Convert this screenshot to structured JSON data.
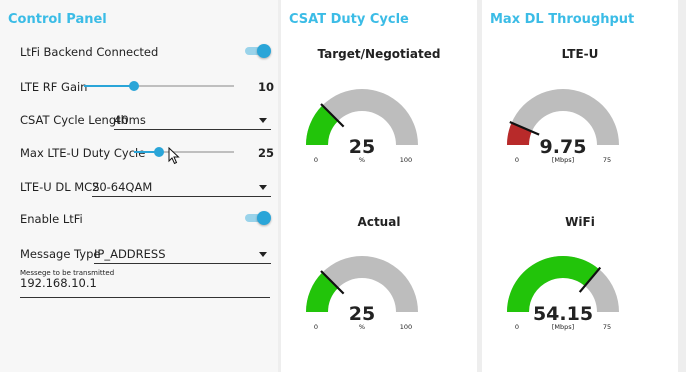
{
  "control_panel": {
    "title": "Control Panel",
    "backend_connected": {
      "label": "LtFi Backend Connected",
      "on": true
    },
    "lte_rf_gain": {
      "label": "LTE RF Gain",
      "value": "10",
      "fraction": 0.33
    },
    "csat_cycle_length": {
      "label": "CSAT Cycle Length",
      "value": "40ms"
    },
    "max_duty_cycle": {
      "label": "Max LTE-U Duty Cycle",
      "value": "25",
      "fraction": 0.25
    },
    "dl_mcs": {
      "label": "LTE-U DL MCS",
      "value": "20-64QAM"
    },
    "enable_ltfi": {
      "label": "Enable LtFi",
      "on": true
    },
    "message_type": {
      "label": "Message Type",
      "value": "IP_ADDRESS"
    },
    "message": {
      "label": "Messege to be transmitted",
      "value": "192.168.10.1"
    }
  },
  "csat_panel": {
    "title": "CSAT Duty Cycle",
    "gauges": [
      {
        "title": "Target/Negotiated",
        "value": 25,
        "display": "25",
        "min": "0",
        "max": "100",
        "min_num": 0,
        "max_num": 100,
        "unit": "%",
        "color": "#22c40a"
      },
      {
        "title": "Actual",
        "value": 25,
        "display": "25",
        "min": "0",
        "max": "100",
        "min_num": 0,
        "max_num": 100,
        "unit": "%",
        "color": "#22c40a"
      }
    ]
  },
  "tput_panel": {
    "title": "Max DL Throughput",
    "gauges": [
      {
        "title": "LTE-U",
        "value": 9.75,
        "display": "9.75",
        "min": "0",
        "max": "75",
        "min_num": 0,
        "max_num": 75,
        "unit": "[Mbps]",
        "color": "#b82a2a"
      },
      {
        "title": "WiFi",
        "value": 54.15,
        "display": "54.15",
        "min": "0",
        "max": "75",
        "min_num": 0,
        "max_num": 75,
        "unit": "[Mbps]",
        "color": "#22c40a"
      }
    ]
  },
  "colors": {
    "accent": "#3bbce6",
    "toggle": "#2aa5d8",
    "gauge_track": "#bdbdbd"
  },
  "icons": {
    "cursor": "mouse-pointer-icon"
  }
}
